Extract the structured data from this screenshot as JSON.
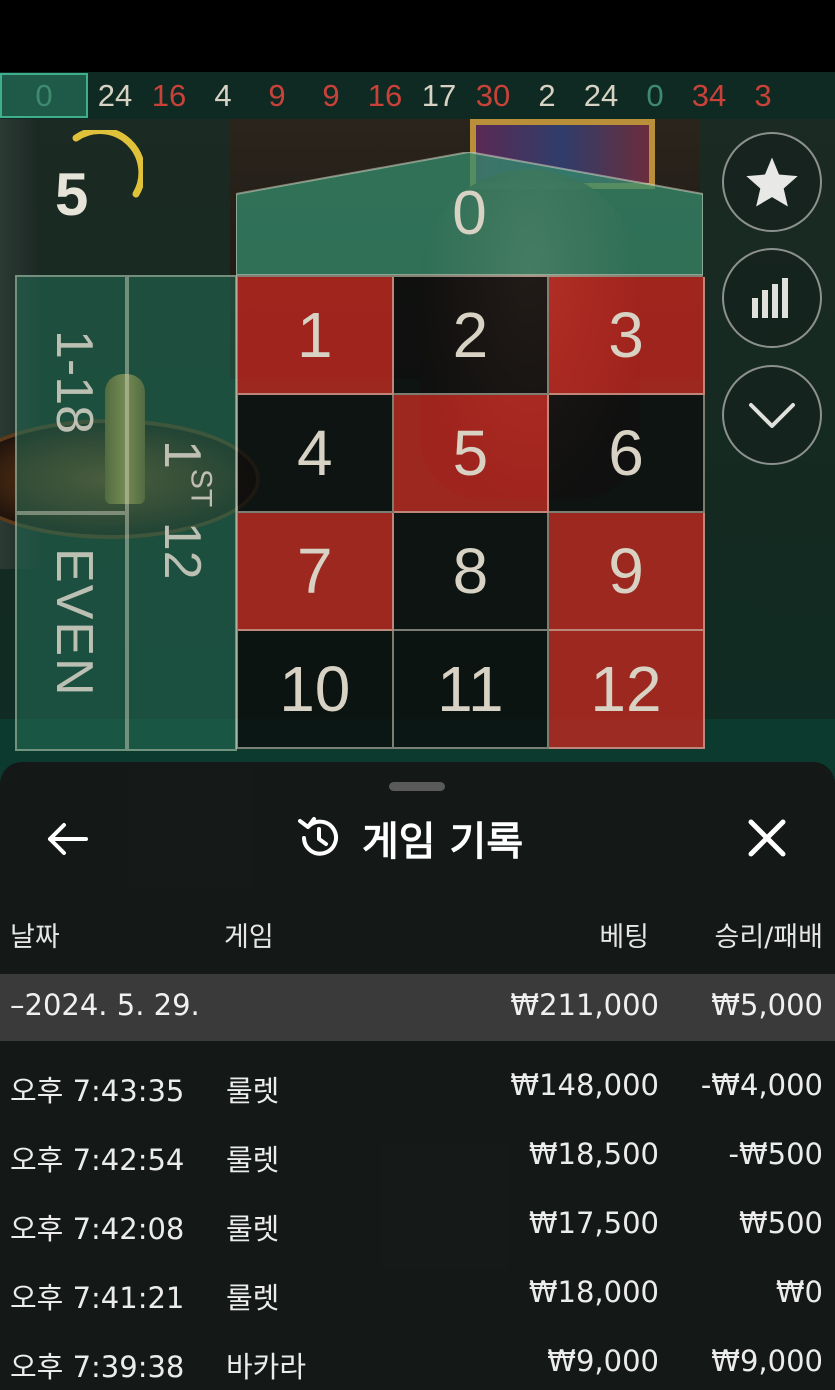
{
  "results_strip": {
    "items": [
      {
        "value": "0",
        "color": "green"
      },
      {
        "value": "24",
        "color": "black"
      },
      {
        "value": "16",
        "color": "red"
      },
      {
        "value": "4",
        "color": "black"
      },
      {
        "value": "9",
        "color": "red"
      },
      {
        "value": "9",
        "color": "red"
      },
      {
        "value": "16",
        "color": "red"
      },
      {
        "value": "17",
        "color": "black"
      },
      {
        "value": "30",
        "color": "red"
      },
      {
        "value": "2",
        "color": "black"
      },
      {
        "value": "24",
        "color": "black"
      },
      {
        "value": "0",
        "color": "green"
      },
      {
        "value": "34",
        "color": "red"
      },
      {
        "value": "3",
        "color": "red"
      }
    ]
  },
  "timer": {
    "seconds": "5"
  },
  "table": {
    "zero_label": "0",
    "low_label": "1-18",
    "even_label": "EVEN",
    "dozen_label_num": "1",
    "dozen_label_sup": "ST",
    "dozen_label_tail": " 12",
    "numbers": [
      {
        "n": "1",
        "color": "red"
      },
      {
        "n": "2",
        "color": "black"
      },
      {
        "n": "3",
        "color": "red"
      },
      {
        "n": "4",
        "color": "black"
      },
      {
        "n": "5",
        "color": "red"
      },
      {
        "n": "6",
        "color": "black"
      },
      {
        "n": "7",
        "color": "red"
      },
      {
        "n": "8",
        "color": "black"
      },
      {
        "n": "9",
        "color": "red"
      },
      {
        "n": "10",
        "color": "black"
      },
      {
        "n": "11",
        "color": "black"
      },
      {
        "n": "12",
        "color": "red"
      }
    ]
  },
  "side_buttons": [
    {
      "name": "favorites-button",
      "icon": "star-icon"
    },
    {
      "name": "statistics-button",
      "icon": "bar-chart-icon"
    },
    {
      "name": "collapse-button",
      "icon": "chevron-down-icon"
    }
  ],
  "history": {
    "title": "게임 기록",
    "headers": {
      "date": "날짜",
      "game": "게임",
      "bet": "베팅",
      "winloss": "승리/패배"
    },
    "date_group": {
      "label": "–2024. 5. 29.",
      "bet": "₩211,000",
      "winloss": "₩5,000"
    },
    "rows": [
      {
        "time": "오후 7:43:35",
        "game": "룰렛",
        "bet": "₩148,000",
        "winloss": "-₩4,000"
      },
      {
        "time": "오후 7:42:54",
        "game": "룰렛",
        "bet": "₩18,500",
        "winloss": "-₩500"
      },
      {
        "time": "오후 7:42:08",
        "game": "룰렛",
        "bet": "₩17,500",
        "winloss": "₩500"
      },
      {
        "time": "오후 7:41:21",
        "game": "룰렛",
        "bet": "₩18,000",
        "winloss": "₩0"
      },
      {
        "time": "오후 7:39:38",
        "game": "바카라",
        "bet": "₩9,000",
        "winloss": "₩9,000"
      }
    ]
  },
  "colors": {
    "red": "#c4281f",
    "green_strip": "#1e5a47",
    "panel": "#161616",
    "date_row": "#3a3a3a"
  }
}
